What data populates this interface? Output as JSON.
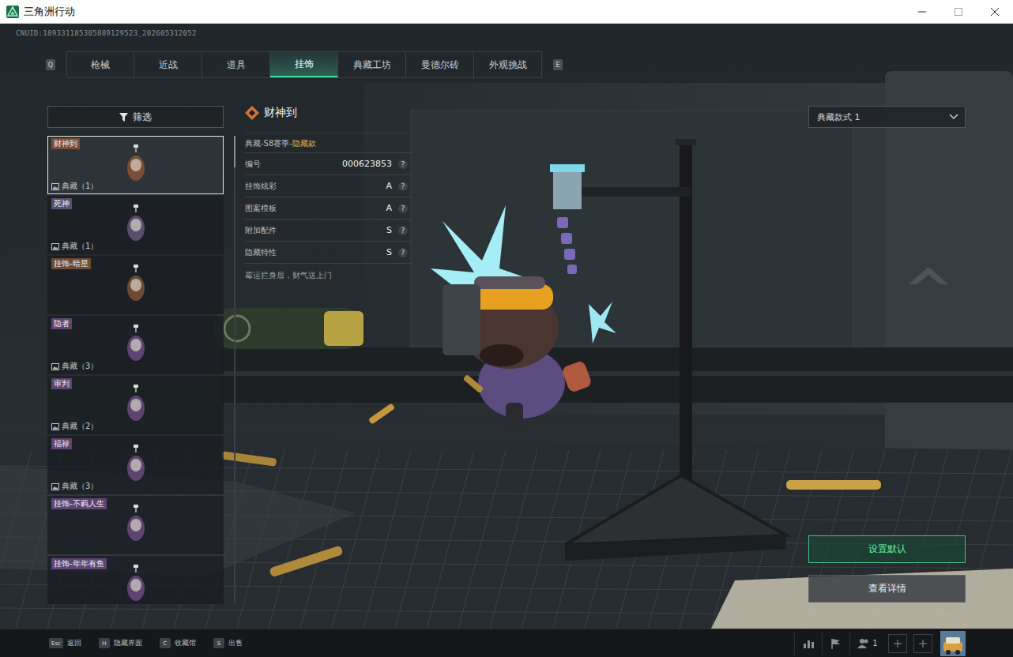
{
  "window": {
    "title": "三角洲行动"
  },
  "uid": "CNUID:189331185305889129523_202605312052",
  "tab_keys": {
    "prev": "Q",
    "next": "E"
  },
  "tabs": [
    {
      "label": "枪械",
      "selected": false
    },
    {
      "label": "近战",
      "selected": false
    },
    {
      "label": "道具",
      "selected": false
    },
    {
      "label": "挂饰",
      "selected": true
    },
    {
      "label": "典藏工坊",
      "selected": false
    },
    {
      "label": "曼德尔砖",
      "selected": false
    },
    {
      "label": "外观挑战",
      "selected": false
    }
  ],
  "filter": {
    "label": "筛选"
  },
  "items": [
    {
      "name": "财神到",
      "count": "典藏（1）",
      "color": "#7a4e36",
      "selected": true
    },
    {
      "name": "死神",
      "count": "典藏（1）",
      "color": "#5a4e6e",
      "selected": false
    },
    {
      "name": "挂饰-暗星",
      "count": "",
      "color": "#6e4a34",
      "selected": false
    },
    {
      "name": "隐者",
      "count": "典藏（3）",
      "color": "#5e4472",
      "selected": false
    },
    {
      "name": "审判",
      "count": "典藏（2）",
      "color": "#5e4472",
      "selected": false
    },
    {
      "name": "福禄",
      "count": "典藏（3）",
      "color": "#5e4472",
      "selected": false
    },
    {
      "name": "挂饰-不羁人生",
      "count": "",
      "color": "#5e4472",
      "selected": false
    },
    {
      "name": "挂饰-年年有鱼",
      "count": "",
      "color": "#5e4472",
      "selected": false
    }
  ],
  "detail": {
    "title": "财神到",
    "series": "典藏-S8赛季-",
    "rarity": "隐藏款",
    "rows": [
      {
        "label": "编号",
        "value": "000623853",
        "help": "?"
      },
      {
        "label": "挂饰炫彩",
        "value": "A",
        "help": "?"
      },
      {
        "label": "图案模板",
        "value": "A",
        "help": "?"
      },
      {
        "label": "附加配件",
        "value": "S",
        "help": "?"
      },
      {
        "label": "隐藏特性",
        "value": "S",
        "help": "?"
      }
    ],
    "description": "霉运拦身后，财气送上门"
  },
  "style_select": {
    "value": "典藏款式 1"
  },
  "buttons": [
    {
      "label": "设置默认",
      "kind": "primary"
    },
    {
      "label": "查看详情",
      "kind": "secondary"
    }
  ],
  "hotkeys": [
    {
      "key": "Esc",
      "label": "返回"
    },
    {
      "key": "H",
      "label": "隐藏界面"
    },
    {
      "key": "C",
      "label": "收藏馆"
    },
    {
      "key": "S",
      "label": "出售"
    }
  ],
  "party_count": "1"
}
